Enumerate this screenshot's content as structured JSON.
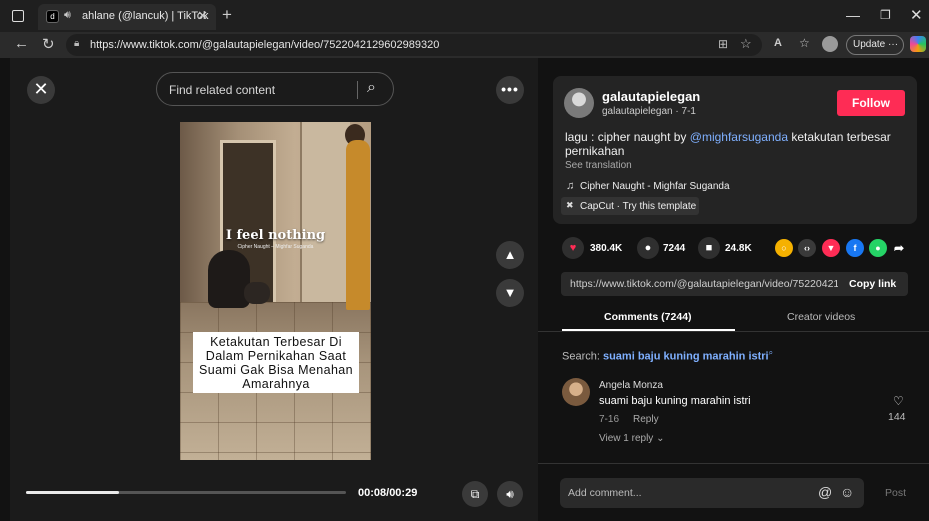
{
  "browser": {
    "tab_title": "ahlane (@lancuk) | TikTok",
    "tab_favicon": "d",
    "url": "https://www.tiktok.com/@galautapielegan/video/7522042129602989320",
    "update_label": "Update",
    "update_more": "···"
  },
  "video": {
    "search_placeholder": "Find related content",
    "overlay_title": "I feel nothing",
    "overlay_sub": "Cipher Naught – Mighfar Suganda",
    "caption": "Ketakutan Terbesar Di Dalam Pernikahan Saat Suami Gak Bisa Menahan Amarahnya",
    "time": "00:08/00:29",
    "progress_fraction": 0.29
  },
  "post": {
    "username": "galautapielegan",
    "handle_date": "galautapielegan · 7-1",
    "follow_label": "Follow",
    "desc_prefix": "lagu : cipher naught by ",
    "desc_mention": "@mighfarsuganda",
    "desc_suffix": " ketakutan terbesar pernikahan",
    "see_translation": "See translation",
    "music": "Cipher Naught - Mighfar Suganda",
    "capcut": "CapCut · Try this template",
    "likes": "380.4K",
    "comments": "7244",
    "saves": "24.8K",
    "link": "https://www.tiktok.com/@galautapielegan/video/7522042129602989320",
    "copy_link": "Copy link"
  },
  "tabs": {
    "comments": "Comments (7244)",
    "creator": "Creator videos"
  },
  "comments": {
    "search_label": "Search: ",
    "search_term": "suami baju kuning marahin istri",
    "items": [
      {
        "name": "Angela Monza",
        "text": "suami baju kuning marahin istri",
        "date": "7-16",
        "reply": "Reply",
        "view_replies": "View 1 reply",
        "likes": "144"
      }
    ],
    "add_placeholder": "Add comment...",
    "post_label": "Post"
  },
  "colors": {
    "accent": "#fe2c55",
    "link": "#7fb0ff"
  }
}
